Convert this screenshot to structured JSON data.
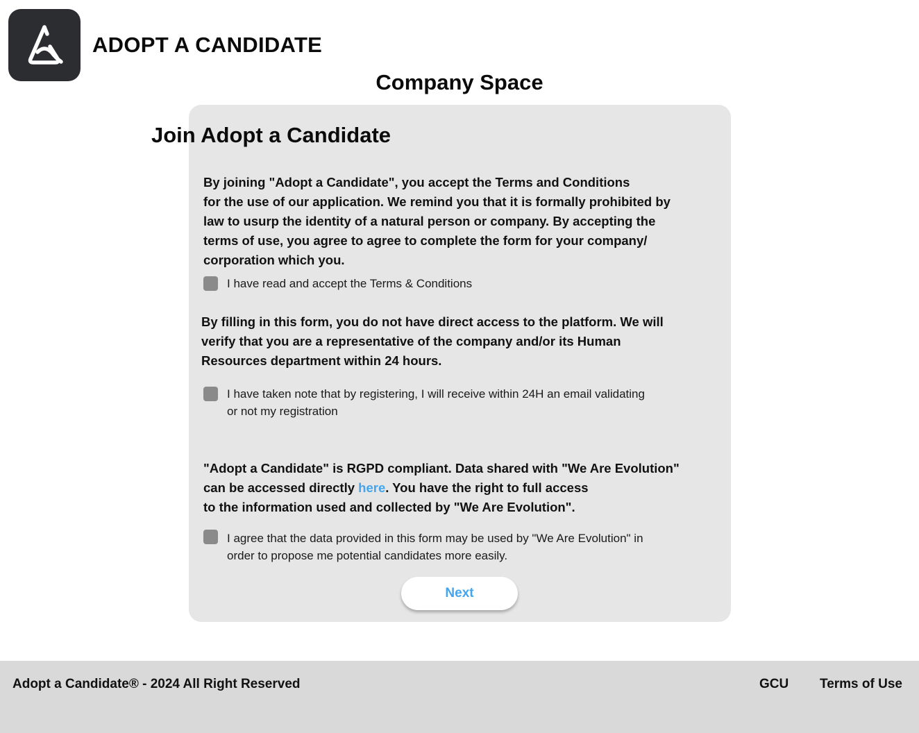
{
  "header": {
    "brand_name": "ADOPT A CANDIDATE",
    "logo_icon": "triangle-knot-logo",
    "page_title": "Company Space"
  },
  "form": {
    "title": "Join Adopt a Candidate",
    "terms_paragraph": [
      "By joining \"Adopt a Candidate\", you accept the Terms and Conditions",
      "for the use of our application. We remind you that it is  formally prohibited by",
      "law to usurp the identity of a natural person or company. By accepting the",
      "terms of use, you agree to agree to complete the form for your company/",
      "corporation which you."
    ],
    "terms_checkbox_label": "I have read and accept the Terms & Conditions",
    "verification_paragraph": [
      "By filling in this form, you do not have direct access to the platform. We will",
      "verify that you are a representative of the company and/or its Human",
      "Resources department within 24 hours."
    ],
    "verification_checkbox_label": [
      "I have taken note that by registering, I will receive within 24H an email validating",
      "or not my registration"
    ],
    "rgpd_paragraph": {
      "line1": "\"Adopt a Candidate\" is RGPD compliant. Data shared with \"We Are Evolution\"",
      "line2_before": "can be accessed directly ",
      "line2_link": "here",
      "line2_after": ". You have the right to full access",
      "line3": "to the information used and collected by \"We Are Evolution\"."
    },
    "data_checkbox_label": [
      "I agree that the data provided in this form may be used by \"We Are Evolution\" in",
      "order to propose me potential candidates more easily."
    ],
    "next_button": "Next"
  },
  "footer": {
    "copyright": "Adopt a Candidate® - 2024 All Right Reserved",
    "links": [
      "GCU",
      "Terms of Use"
    ]
  },
  "colors": {
    "card_background": "#e6e6e6",
    "footer_background": "#d9d9d9",
    "logo_background": "#2c2d31",
    "accent_link": "#45a5ec",
    "checkbox": "#8a8a8a"
  }
}
